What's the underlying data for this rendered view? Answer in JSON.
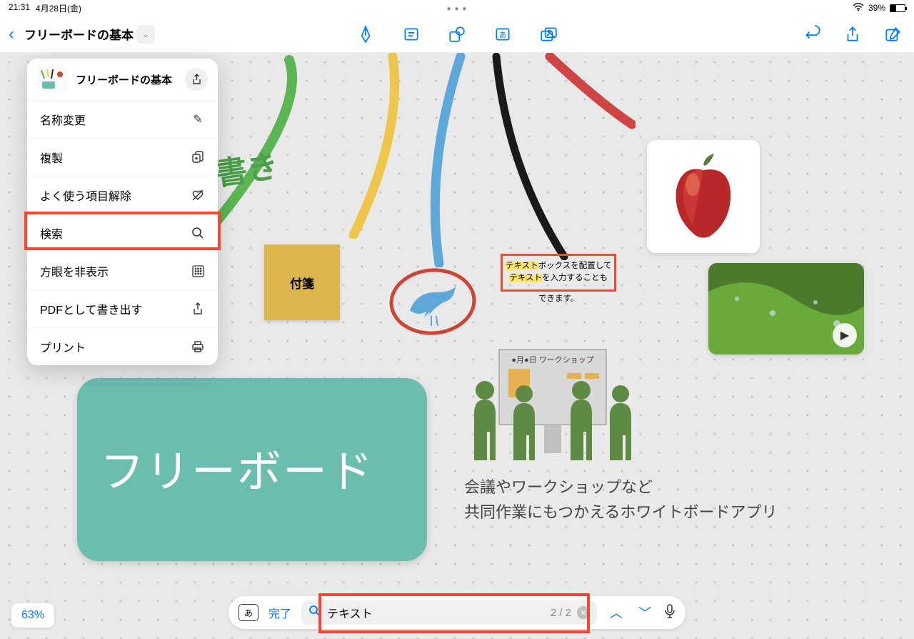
{
  "status": {
    "time": "21:31",
    "date": "4月28日(金)",
    "battery_pct": "39%"
  },
  "header": {
    "title": "フリーボードの基本"
  },
  "menu": {
    "title": "フリーボードの基本",
    "items": [
      {
        "label": "名称変更",
        "icon": "pencil"
      },
      {
        "label": "複製",
        "icon": "duplicate"
      },
      {
        "label": "よく使う項目解除",
        "icon": "heart-slash"
      },
      {
        "label": "検索",
        "icon": "search"
      },
      {
        "label": "方眼を非表示",
        "icon": "grid"
      },
      {
        "label": "PDFとして書き出す",
        "icon": "export"
      },
      {
        "label": "プリント",
        "icon": "print"
      }
    ]
  },
  "canvas": {
    "sticky_label": "付箋",
    "textbox_line1_a": "テキスト",
    "textbox_line1_b": "ボックスを配置して",
    "textbox_line2_a": "テキスト",
    "textbox_line2_b": "を入力することも",
    "textbox_line3": "できます。",
    "board_text": "フリーボード",
    "hand_text": "書き",
    "workshop_label": "●月●日 ワークショップ",
    "handwriting_line1": "会議やワークショップなど",
    "handwriting_line2": "共同作業にもつかえるホワイトボードアプリ"
  },
  "search": {
    "done": "完了",
    "query": "テキスト",
    "count": "2 / 2"
  },
  "zoom": "63%"
}
